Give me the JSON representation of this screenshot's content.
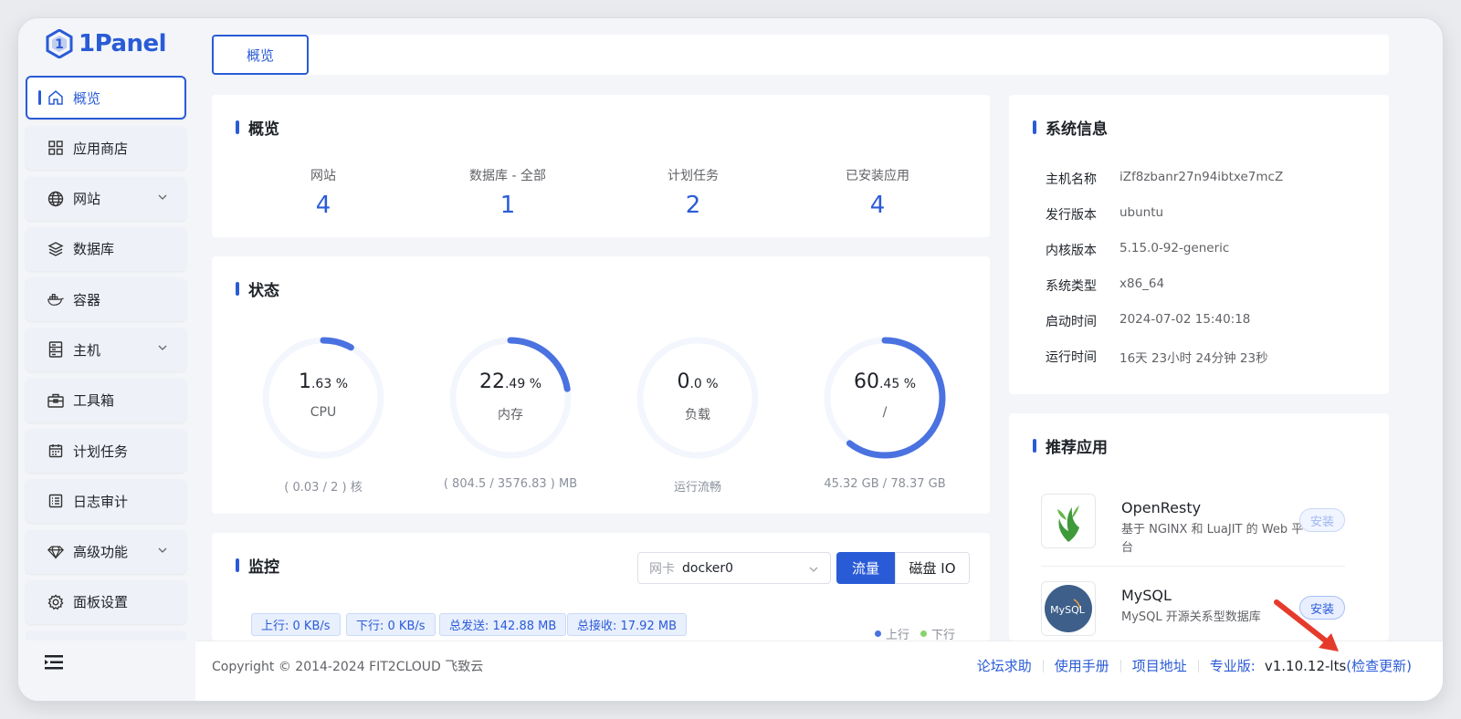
{
  "app": {
    "name": "1Panel"
  },
  "sidebar": {
    "items": [
      {
        "label": "概览",
        "icon": "home-icon",
        "active": true
      },
      {
        "label": "应用商店",
        "icon": "grid-icon"
      },
      {
        "label": "网站",
        "icon": "globe-icon",
        "expandable": true
      },
      {
        "label": "数据库",
        "icon": "layers-icon"
      },
      {
        "label": "容器",
        "icon": "docker-icon"
      },
      {
        "label": "主机",
        "icon": "server-icon",
        "expandable": true
      },
      {
        "label": "工具箱",
        "icon": "toolbox-icon"
      },
      {
        "label": "计划任务",
        "icon": "calendar-icon"
      },
      {
        "label": "日志审计",
        "icon": "log-icon"
      },
      {
        "label": "高级功能",
        "icon": "diamond-icon",
        "expandable": true
      },
      {
        "label": "面板设置",
        "icon": "gear-icon"
      }
    ]
  },
  "topbar": {
    "tab": "概览"
  },
  "overview": {
    "title": "概览",
    "stats": [
      {
        "label": "网站",
        "value": "4"
      },
      {
        "label": "数据库 - 全部",
        "value": "1"
      },
      {
        "label": "计划任务",
        "value": "2"
      },
      {
        "label": "已安装应用",
        "value": "4"
      }
    ]
  },
  "status": {
    "title": "状态",
    "gauges": [
      {
        "int": "1",
        "dec": ".63 %",
        "name": "CPU",
        "sub": "( 0.03 / 2 ) 核",
        "percent": 1.63
      },
      {
        "int": "22",
        "dec": ".49 %",
        "name": "内存",
        "sub": "( 804.5 / 3576.83 ) MB",
        "percent": 22.49
      },
      {
        "int": "0",
        "dec": ".0 %",
        "name": "负载",
        "sub": "运行流畅",
        "percent": 0
      },
      {
        "int": "60",
        "dec": ".45 %",
        "name": "/",
        "sub": "45.32 GB / 78.37 GB",
        "percent": 60.45
      }
    ]
  },
  "monitor": {
    "title": "监控",
    "nic_label": "网卡",
    "nic_value": "docker0",
    "seg_on": "流量",
    "seg_off": "磁盘 IO",
    "tags": [
      "上行: 0 KB/s",
      "下行: 0 KB/s",
      "总发送: 142.88 MB",
      "总接收: 17.92 MB"
    ],
    "legend": [
      {
        "label": "上行",
        "color": "#4a72e0"
      },
      {
        "label": "下行",
        "color": "#86d46b"
      }
    ]
  },
  "sysinfo": {
    "title": "系统信息",
    "rows": [
      {
        "key": "主机名称",
        "value": "iZf8zbanr27n94ibtxe7mcZ"
      },
      {
        "key": "发行版本",
        "value": "ubuntu"
      },
      {
        "key": "内核版本",
        "value": "5.15.0-92-generic"
      },
      {
        "key": "系统类型",
        "value": "x86_64"
      },
      {
        "key": "启动时间",
        "value": "2024-07-02 15:40:18"
      },
      {
        "key": "运行时间",
        "value": "16天 23小时 24分钟 23秒"
      }
    ]
  },
  "apps": {
    "title": "推荐应用",
    "items": [
      {
        "name": "OpenResty",
        "desc": "基于 NGINX 和 LuaJIT 的 Web 平台",
        "button": "安装"
      },
      {
        "name": "MySQL",
        "desc": "MySQL 开源关系型数据库",
        "button": "安装",
        "logo_text": "MySQL"
      }
    ]
  },
  "footer": {
    "copyright": "Copyright © 2014-2024 FIT2CLOUD 飞致云",
    "links": [
      "论坛求助",
      "使用手册",
      "项目地址",
      "专业版:"
    ],
    "version": "v1.10.12-lts",
    "check_update": "(检查更新)"
  },
  "colors": {
    "accent": "#2a5bd7",
    "arrow": "#e53b2c"
  }
}
